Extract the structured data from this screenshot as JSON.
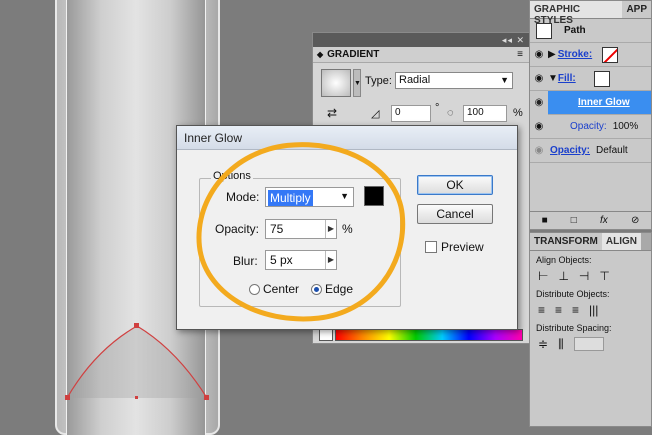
{
  "gradient_panel": {
    "title": "GRADIENT",
    "type_label": "Type:",
    "type_value": "Radial",
    "angle_value": "0",
    "angle_unit": "°",
    "aspect_value": "100",
    "aspect_unit": "%"
  },
  "graphic_styles_panel": {
    "tabs": [
      "GRAPHIC STYLES",
      "APP"
    ],
    "rows": [
      {
        "label": "Path"
      },
      {
        "label": "Stroke:"
      },
      {
        "label": "Fill:"
      },
      {
        "label": "Inner Glow"
      },
      {
        "label": "Opacity:",
        "value": "100%"
      },
      {
        "label": "Opacity:",
        "value": "Default"
      }
    ]
  },
  "transform_panel": {
    "tabs": [
      "TRANSFORM",
      "ALIGN"
    ],
    "align_objects": "Align Objects:",
    "distribute_objects": "Distribute Objects:",
    "distribute_spacing": "Distribute Spacing:"
  },
  "dialog": {
    "title": "Inner Glow",
    "options_legend": "Options",
    "mode_label": "Mode:",
    "mode_value": "Multiply",
    "opacity_label": "Opacity:",
    "opacity_value": "75",
    "opacity_unit": "%",
    "blur_label": "Blur:",
    "blur_value": "5 px",
    "center_label": "Center",
    "edge_label": "Edge",
    "ok_label": "OK",
    "cancel_label": "Cancel",
    "preview_label": "Preview",
    "glow_color": "#000000"
  },
  "colors": {
    "annotation": "#f3aa1e",
    "selection": "#3a8ef0"
  }
}
